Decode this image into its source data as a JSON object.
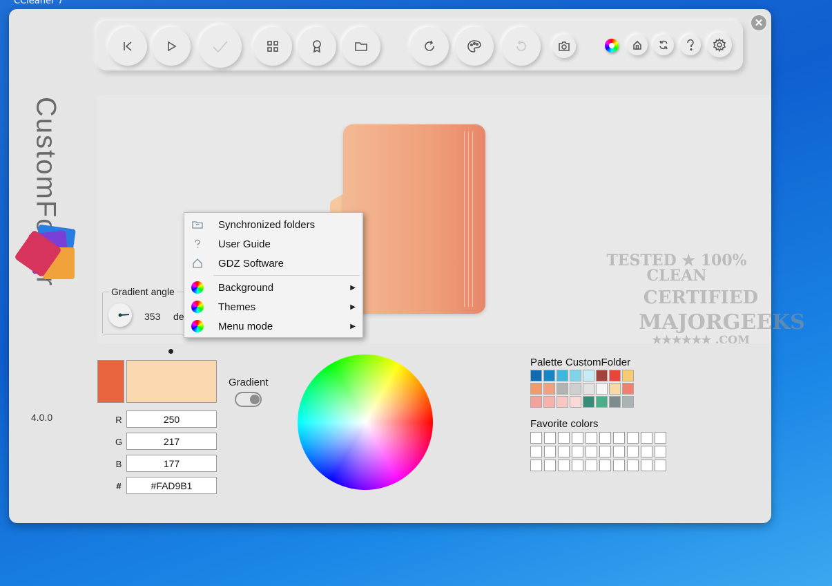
{
  "window": {
    "title": "CCleaner 7",
    "close_glyph": "✕"
  },
  "brand": {
    "vertical_text": "CustomFolder",
    "version": "4.0.0"
  },
  "toolbar": {
    "buttons": [
      {
        "icon": "skip-back-icon",
        "enabled": true
      },
      {
        "icon": "play-icon",
        "enabled": true
      },
      {
        "icon": "check-icon",
        "enabled": false
      },
      {
        "icon": "grid-icon",
        "enabled": true
      },
      {
        "icon": "award-icon",
        "enabled": true
      },
      {
        "icon": "folder-icon",
        "enabled": true
      },
      {
        "icon": "refresh-icon",
        "enabled": true
      },
      {
        "icon": "palette-icon",
        "enabled": true
      },
      {
        "icon": "undo-icon",
        "enabled": false
      },
      {
        "icon": "camera-icon",
        "enabled": true
      },
      {
        "icon": "color-wheel-icon",
        "enabled": true
      },
      {
        "icon": "home-icon",
        "enabled": true
      },
      {
        "icon": "sync-icon",
        "enabled": true
      },
      {
        "icon": "help-icon",
        "enabled": true
      },
      {
        "icon": "settings-icon",
        "enabled": true
      }
    ]
  },
  "gradient_angle": {
    "label": "Gradient angle",
    "value": "353",
    "unit": "de"
  },
  "context_menu": {
    "items": [
      {
        "label": "Synchronized folders",
        "icon": "sync-folder-icon",
        "submenu": false
      },
      {
        "label": "User Guide",
        "icon": "help-icon",
        "submenu": false
      },
      {
        "label": "GDZ Software",
        "icon": "home-icon",
        "submenu": false
      },
      {
        "label": "Background",
        "icon": "color-wheel-icon",
        "submenu": true
      },
      {
        "label": "Themes",
        "icon": "color-wheel-icon",
        "submenu": true
      },
      {
        "label": "Menu mode",
        "icon": "color-wheel-icon",
        "submenu": true
      }
    ],
    "submenu_glyph": "▶"
  },
  "watermark": {
    "line1": "TESTED ★ 100% CLEAN",
    "line2": "CERTIFIED",
    "line3": "MAJORGEEKS",
    "line4": "★★★★★★ .COM"
  },
  "colors": {
    "primary": "#E8643F",
    "secondary": "#FAD9B1",
    "gradient_label": "Gradient",
    "gradient_on": true,
    "r_label": "R",
    "r_value": "250",
    "g_label": "G",
    "g_value": "217",
    "b_label": "B",
    "b_value": "177",
    "hex_label": "#",
    "hex_value": "#FAD9B1"
  },
  "palette": {
    "title": "Palette CustomFolder",
    "swatches": [
      "#0E6DB2",
      "#1585C6",
      "#3DB7DE",
      "#7FD3EA",
      "#C6EBF5",
      "#A3413A",
      "#E8463B",
      "#F7CB70",
      "#F39A6B",
      "#F2A07F",
      "#B3B3B3",
      "#CFCFCF",
      "#E3E3E3",
      "#F5F5F5",
      "#F9D9A2",
      "#F07F6F",
      "#F2A29A",
      "#F4B3AC",
      "#F7C7C2",
      "#FAD9D6",
      "#3A8A7A",
      "#4AAE8A",
      "#7C8C8C",
      "#A9B3B3"
    ]
  },
  "favorites": {
    "title": "Favorite colors",
    "count": 30
  }
}
